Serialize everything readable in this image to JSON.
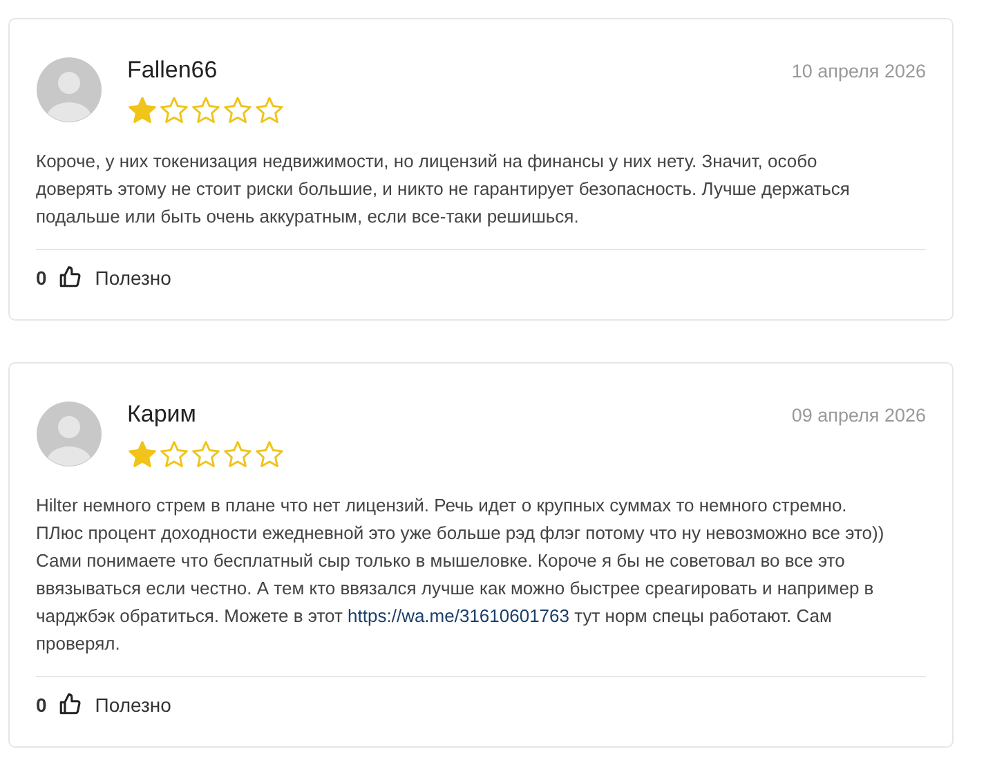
{
  "reviews": [
    {
      "author": "Fallen66",
      "date": "10 апреля 2026",
      "stars": 1,
      "body": [
        {
          "kind": "text",
          "text": "Короче, у них токенизация недвижимости, но лицензий на финансы у них нету. Значит, особо доверять этому не стоит риски большие, и никто не гарантирует безопасность. Лучше держаться подальше или быть очень аккуратным, если все-таки решишься."
        }
      ],
      "likes": "0",
      "helpful_label": "Полезно"
    },
    {
      "author": "Карим",
      "date": "09 апреля 2026",
      "stars": 1,
      "body": [
        {
          "kind": "text",
          "text": "Hilter немного стрем в плане что нет лицензий. Речь идет о крупных суммах то немного стремно. ПЛюс процент доходности ежедневной это уже больше рэд флэг потому что ну невозможно все это)) Сами понимаете что бесплатный сыр только в мышеловке. Короче я бы не советовал во все это ввязываться если честно. А тем кто ввязался лучше как можно быстрее среагировать и например в чарджбэк обратиться. Можете в этот "
        },
        {
          "kind": "link",
          "text": "https://wa.me/31610601763"
        },
        {
          "kind": "text",
          "text": " тут норм спецы работают. Сам проверял."
        }
      ],
      "likes": "0",
      "helpful_label": "Полезно"
    }
  ]
}
